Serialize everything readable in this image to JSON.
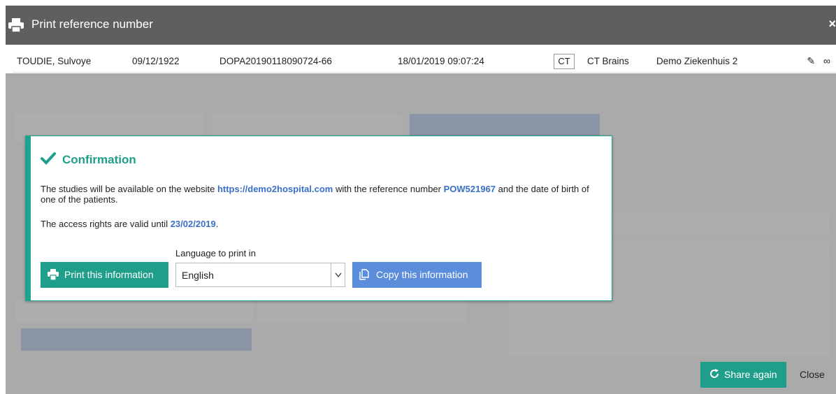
{
  "dialog": {
    "title": "Print reference number",
    "close_icon": "close-icon"
  },
  "study": {
    "patient_name": "TOUDIE, Sulvoye",
    "birth_date": "09/12/1922",
    "accession": "DOPA20190118090724-66",
    "study_datetime": "18/01/2019 09:07:24",
    "modality": "CT",
    "description": "CT Brains",
    "institution": "Demo Ziekenhuis 2"
  },
  "confirmation": {
    "heading": "Confirmation",
    "msg_part1": "The studies will be available on the website ",
    "website": "https://demo2hospital.com",
    "msg_part2": " with the reference number ",
    "reference": "POW521967",
    "msg_part3": " and the date of birth of one of the patients.",
    "valid_prefix": "The access rights are valid until ",
    "valid_date": "23/02/2019",
    "valid_suffix": ".",
    "language_label": "Language to print in",
    "language_value": "English",
    "print_label": "Print this information",
    "copy_label": "Copy this information"
  },
  "footer": {
    "share_label": "Share again",
    "close_label": "Close"
  },
  "colors": {
    "accent_green": "#1f9e8a",
    "accent_blue": "#5b8ddb",
    "title_bar": "#5f5f5f"
  }
}
